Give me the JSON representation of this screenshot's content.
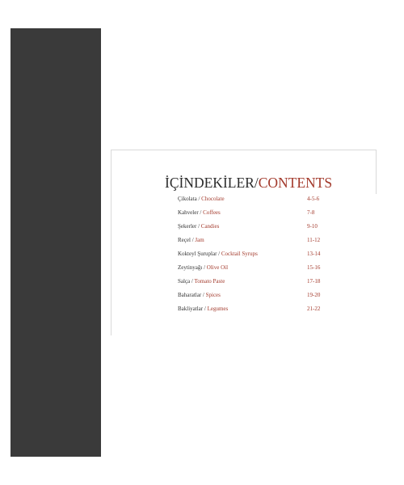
{
  "title": {
    "turkish": "İÇİNDEKİLER",
    "separator": "/",
    "english": "CONTENTS"
  },
  "entries": [
    {
      "turkish": "Çikolata",
      "english": "Chocolate",
      "pages": "4-5-6"
    },
    {
      "turkish": "Kahveler",
      "english": "Coffees",
      "pages": "7-8"
    },
    {
      "turkish": "Şekerler",
      "english": "Candies",
      "pages": "9-10"
    },
    {
      "turkish": "Reçel",
      "english": "Jam",
      "pages": "11-12"
    },
    {
      "turkish": "Kokteyl Şuruplar",
      "english": "Cocktail Syrups",
      "pages": "13-14"
    },
    {
      "turkish": "Zeytinyağı",
      "english": "Olive Oil",
      "pages": "15-16"
    },
    {
      "turkish": "Salça",
      "english": "Tomato Paste",
      "pages": "17-18"
    },
    {
      "turkish": "Baharatlar",
      "english": "Spices",
      "pages": "19-20"
    },
    {
      "turkish": "Bakliyatlar",
      "english": "Legumes",
      "pages": "21-22"
    }
  ],
  "entry_separator": "/",
  "colors": {
    "side_band": "#3a3a3a",
    "accent": "#a33a2c",
    "text": "#333333"
  }
}
